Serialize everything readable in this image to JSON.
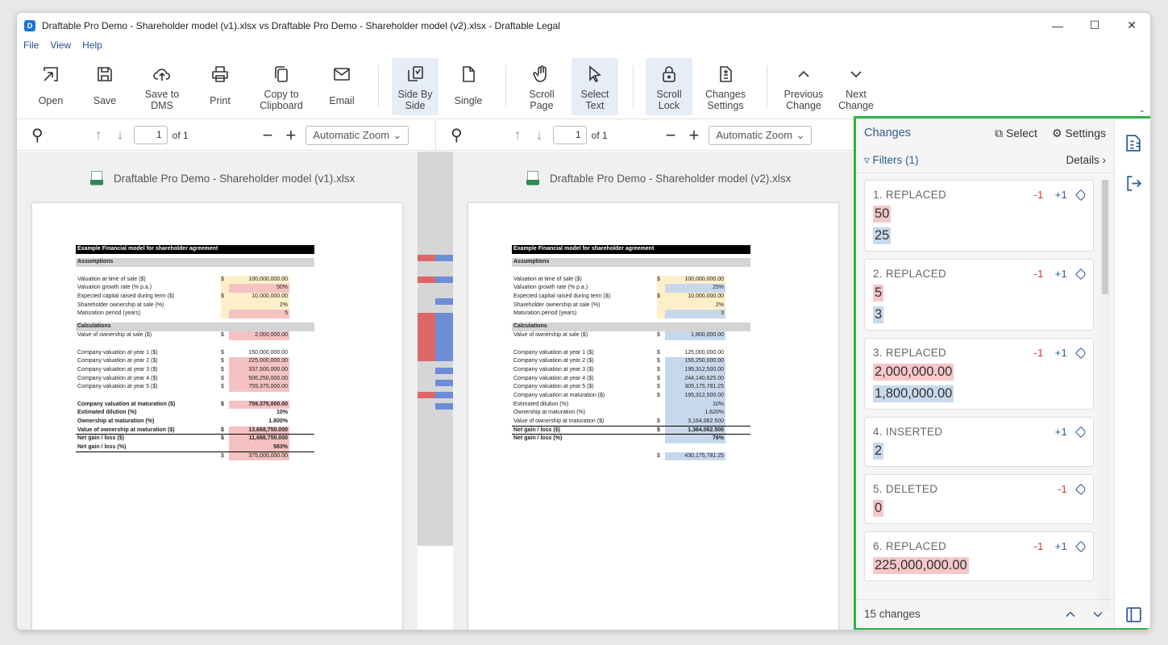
{
  "window": {
    "title": "Draftable Pro Demo - Shareholder model (v1).xlsx vs Draftable Pro Demo - Shareholder model (v2).xlsx - Draftable Legal",
    "app_icon": "D"
  },
  "menu": [
    "File",
    "View",
    "Help"
  ],
  "ribbon": {
    "open": "Open",
    "save": "Save",
    "save_dms": "Save to\nDMS",
    "print": "Print",
    "copy": "Copy to\nClipboard",
    "email": "Email",
    "side_by_side": "Side By\nSide",
    "single": "Single",
    "scroll_page": "Scroll\nPage",
    "select_text": "Select\nText",
    "scroll_lock": "Scroll\nLock",
    "changes_settings": "Changes\nSettings",
    "previous_change": "Previous\nChange",
    "next_change": "Next\nChange"
  },
  "viewer": {
    "left": {
      "page": "1",
      "of": "of 1",
      "zoom": "Automatic Zoom",
      "file": "Draftable Pro Demo - Shareholder model (v1).xlsx"
    },
    "right": {
      "page": "1",
      "of": "of 1",
      "zoom": "Automatic Zoom",
      "file": "Draftable Pro Demo - Shareholder model (v2).xlsx"
    }
  },
  "sheet_left": {
    "header": "Example Financial model for shareholder agreement",
    "assumptions": "Assumptions",
    "calculations": "Calculations",
    "a_rows": [
      [
        "Valuation at time of sale ($)",
        "$",
        "100,000,000.00"
      ],
      [
        "Valuation growth rate (% p.a.)",
        "",
        "50%"
      ],
      [
        "Expected capital raised during term ($)",
        "$",
        "10,000,000.00"
      ],
      [
        "Shareholder ownership at sale (%)",
        "",
        "2%"
      ],
      [
        "Maturation period (years)",
        "",
        "5"
      ]
    ],
    "voo": [
      "Value of ownership at sale ($)",
      "$",
      "2,000,000.00"
    ],
    "years": [
      [
        "Company valuation at year 1 ($)",
        "$",
        "150,000,000.00"
      ],
      [
        "Company valuation at year 2 ($)",
        "$",
        "225,000,000.00"
      ],
      [
        "Company valuation at year 3 ($)",
        "$",
        "337,500,000.00"
      ],
      [
        "Company valuation at year 4 ($)",
        "$",
        "506,250,000.00"
      ],
      [
        "Company valuation at year 5 ($)",
        "$",
        "759,375,000.00"
      ]
    ],
    "mat": [
      [
        "Company valuation at maturation ($)",
        "$",
        "759,375,000.00"
      ],
      [
        "Estimated dilution (%)",
        "",
        "10%"
      ],
      [
        "Ownership at maturation (%)",
        "",
        "1.800%"
      ],
      [
        "Value of ownership at maturation ($)",
        "$",
        "13,668,750.000"
      ],
      [
        "Net gain / loss ($)",
        "$",
        "11,668,750.000"
      ],
      [
        "Net gain / loss (%)",
        "",
        "583%"
      ]
    ],
    "extra": [
      "",
      "$",
      "375,000,000.00"
    ]
  },
  "sheet_right": {
    "header": "Example Financial model for shareholder agreement",
    "assumptions": "Assumptions",
    "calculations": "Calculations",
    "a_rows": [
      [
        "Valuation at time of sale ($)",
        "$",
        "100,000,000.00"
      ],
      [
        "Valuation growth rate (% p.a.)",
        "",
        "25%"
      ],
      [
        "Expected capital raised during term ($)",
        "$",
        "10,000,000.00"
      ],
      [
        "Shareholder ownership at sale (%)",
        "",
        "2%"
      ],
      [
        "Maturation period (years)",
        "",
        "3"
      ]
    ],
    "voo": [
      "Value of ownership at sale ($)",
      "$",
      "1,800,000.00"
    ],
    "years": [
      [
        "Company valuation at year 1 ($)",
        "$",
        "125,000,000.00"
      ],
      [
        "Company valuation at year 2 ($)",
        "$",
        "156,250,000.00"
      ],
      [
        "Company valuation at year 3 ($)",
        "$",
        "195,312,500.00"
      ],
      [
        "Company valuation at year 4 ($)",
        "$",
        "244,140,625.00"
      ],
      [
        "Company valuation at year 5 ($)",
        "$",
        "305,175,781.25"
      ],
      [
        "Company valuation at maturation ($)",
        "$",
        "195,312,500.00"
      ],
      [
        "Estimated dilution (%)",
        "",
        "10%"
      ],
      [
        "Ownership at maturation (%)",
        "",
        "1.620%"
      ],
      [
        "Value of ownership at maturation ($)",
        "$",
        "3,164,062.500"
      ]
    ],
    "mat": [
      [
        "Net gain / loss ($)",
        "$",
        "1,364,062.500"
      ],
      [
        "Net gain / loss (%)",
        "",
        "76%"
      ]
    ],
    "extra": [
      "",
      "$",
      "430,175,781.25"
    ]
  },
  "changes": {
    "title": "Changes",
    "select": "Select",
    "settings": "Settings",
    "filters": "Filters (1)",
    "details": "Details",
    "count": "15 changes",
    "cards": [
      {
        "head": "1. REPLACED",
        "minus": "-1",
        "plus": "+1",
        "del": "50",
        "ins": "25"
      },
      {
        "head": "2. REPLACED",
        "minus": "-1",
        "plus": "+1",
        "del": "5",
        "ins": "3"
      },
      {
        "head": "3. REPLACED",
        "minus": "-1",
        "plus": "+1",
        "del": "2,000,000.00",
        "ins": "1,800,000.00"
      },
      {
        "head": "4. INSERTED",
        "minus": "",
        "plus": "+1",
        "del": "",
        "ins": "2"
      },
      {
        "head": "5. DELETED",
        "minus": "-1",
        "plus": "",
        "del": "0",
        "ins": ""
      },
      {
        "head": "6. REPLACED",
        "minus": "-1",
        "plus": "+1",
        "del": "225,000,000.00",
        "ins": ""
      }
    ]
  }
}
